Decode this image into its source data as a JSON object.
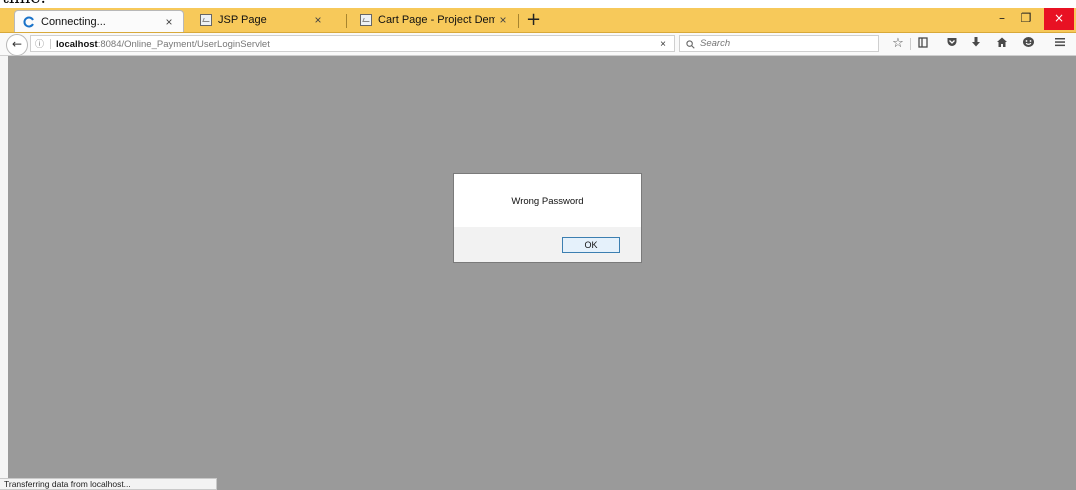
{
  "cropped_caption": "time.",
  "tabs": [
    {
      "label": "Connecting...",
      "state": "loading"
    },
    {
      "label": "JSP Page"
    },
    {
      "label": "Cart Page - Project Demo"
    }
  ],
  "icons": {
    "new_tab": "+",
    "tab_close": "×",
    "minimize": "–",
    "restore": "❐",
    "close": "×",
    "back": "🡐",
    "info": "ⓘ",
    "stop": "×",
    "search": "🔍"
  },
  "url": {
    "host": "localhost",
    "path": ":8084/Online_Payment/UserLoginServlet"
  },
  "search": {
    "placeholder": "Search"
  },
  "dialog": {
    "message": "Wrong Password",
    "ok_label": "OK"
  },
  "status_text": "Transferring data from localhost...",
  "colors": {
    "tabstrip": "#f7c95a",
    "content_overlay": "#9a9a9a",
    "close_button": "#e81123",
    "spinner": "#1a73c9"
  }
}
